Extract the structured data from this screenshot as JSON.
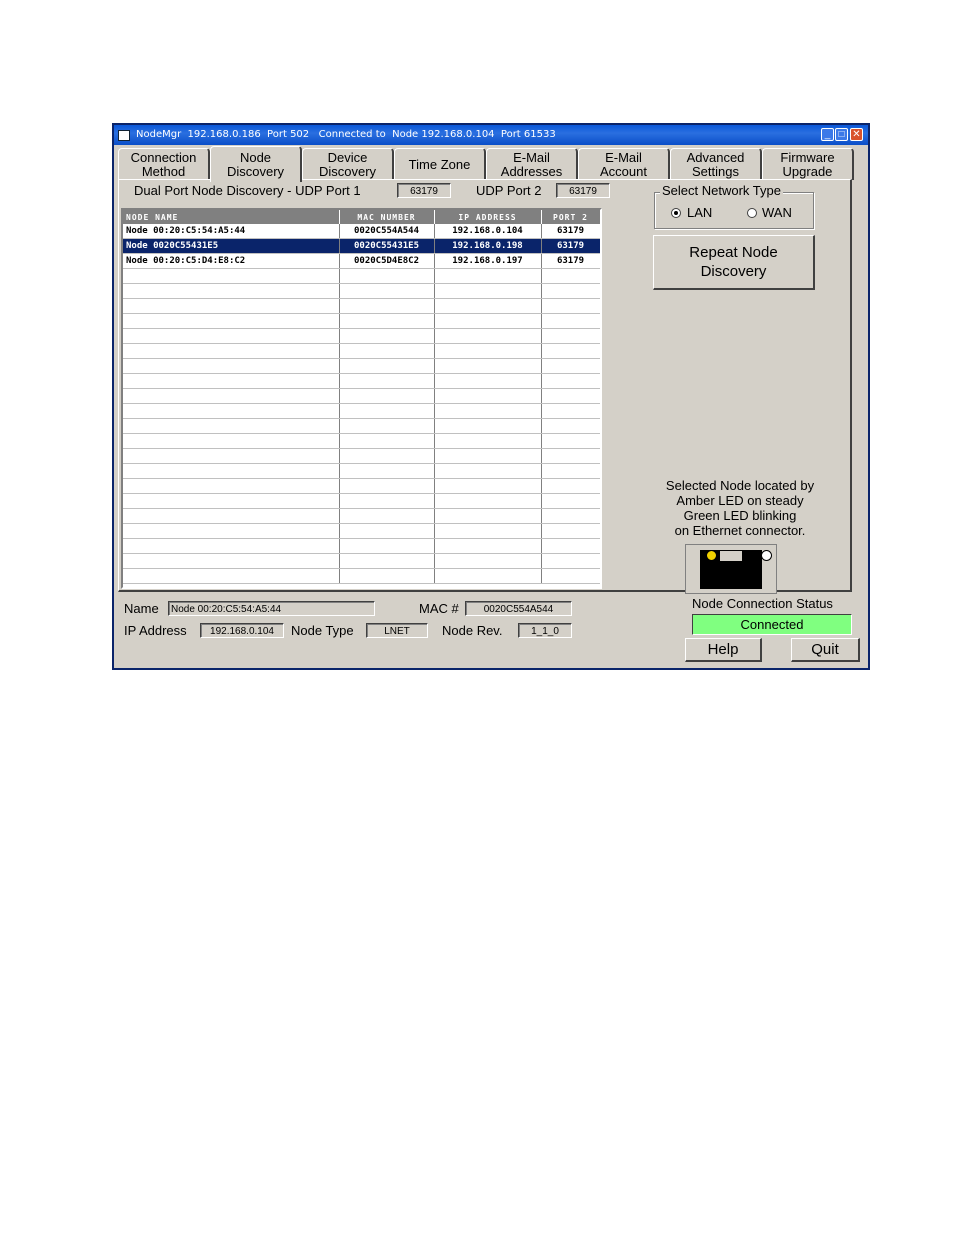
{
  "window": {
    "title": "NodeMgr  192.168.0.186  Port 502   Connected to  Node 192.168.0.104  Port 61533",
    "minimize": "_",
    "maximize": "□",
    "close": "✕"
  },
  "tabs": [
    {
      "label": "Connection\nMethod"
    },
    {
      "label": "Node\nDiscovery"
    },
    {
      "label": "Device\nDiscovery"
    },
    {
      "label": "Time Zone"
    },
    {
      "label": "E-Mail\nAddresses"
    },
    {
      "label": "E-Mail\nAccount"
    },
    {
      "label": "Advanced\nSettings"
    },
    {
      "label": "Firmware\nUpgrade"
    }
  ],
  "discovery": {
    "port1_label": "Dual Port Node Discovery - UDP Port 1",
    "port1_value": "63179",
    "port2_label": "UDP Port 2",
    "port2_value": "63179"
  },
  "grid": {
    "headers": [
      "NODE NAME",
      "MAC NUMBER",
      "IP ADDRESS",
      "PORT 2"
    ],
    "rows": [
      [
        "Node 00:20:C5:54:A5:44",
        "0020C554A544",
        "192.168.0.104",
        "63179"
      ],
      [
        "Node 0020C55431E5",
        "0020C55431E5",
        "192.168.0.198",
        "63179"
      ],
      [
        "Node 00:20:C5:D4:E8:C2",
        "0020C5D4E8C2",
        "192.168.0.197",
        "63179"
      ]
    ],
    "selected_row": 1
  },
  "network_type": {
    "title": "Select Network Type",
    "lan": "LAN",
    "wan": "WAN",
    "selected": "LAN"
  },
  "repeat_button": "Repeat Node\nDiscovery",
  "led_note": "Selected Node located by\nAmber LED on steady\nGreen LED blinking\non Ethernet connector.",
  "colors": {
    "amber_led": "#f0d000",
    "green_led": "#ffffff",
    "status": "#80ff80"
  },
  "details": {
    "name_label": "Name",
    "name_value": "Node 00:20:C5:54:A5:44",
    "mac_label": "MAC #",
    "mac_value": "0020C554A544",
    "ip_label": "IP Address",
    "ip_value": "192.168.0.104",
    "type_label": "Node Type",
    "type_value": "LNET",
    "rev_label": "Node Rev.",
    "rev_value": "1_1_0"
  },
  "status": {
    "label": "Node Connection Status",
    "value": "Connected"
  },
  "help_button": "Help",
  "quit_button": "Quit"
}
